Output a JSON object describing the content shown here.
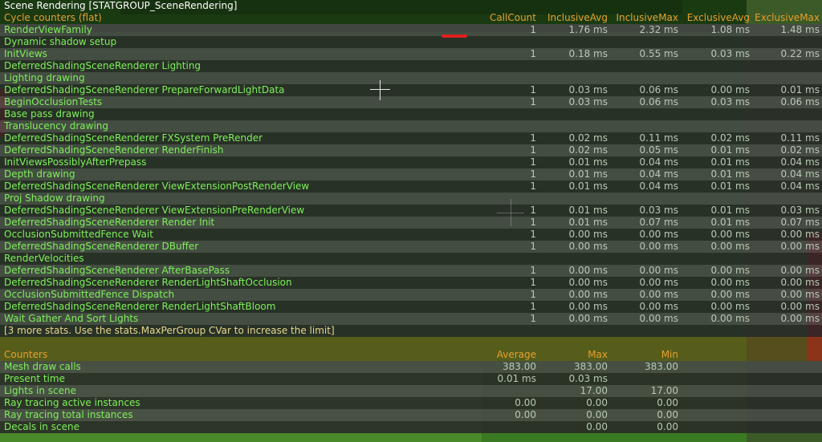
{
  "group_title": "Scene Rendering [STATGROUP_SceneRendering]",
  "cycle": {
    "title": "Cycle counters (flat)",
    "columns": [
      "CallCount",
      "InclusiveAvg",
      "InclusiveMax",
      "ExclusiveAvg",
      "ExclusiveMax"
    ],
    "rows": [
      {
        "name": "RenderViewFamily",
        "vals": [
          "1",
          "1.76 ms",
          "2.32 ms",
          "1.08 ms",
          "1.48 ms"
        ]
      },
      {
        "name": "Dynamic shadow setup",
        "vals": [
          "",
          "",
          "",
          "",
          ""
        ]
      },
      {
        "name": "InitViews",
        "vals": [
          "1",
          "0.18 ms",
          "0.55 ms",
          "0.03 ms",
          "0.22 ms"
        ]
      },
      {
        "name": "DeferredShadingSceneRenderer Lighting",
        "vals": [
          "",
          "",
          "",
          "",
          ""
        ]
      },
      {
        "name": "Lighting drawing",
        "vals": [
          "",
          "",
          "",
          "",
          ""
        ]
      },
      {
        "name": "DeferredShadingSceneRenderer PrepareForwardLightData",
        "vals": [
          "1",
          "0.03 ms",
          "0.06 ms",
          "0.00 ms",
          "0.01 ms"
        ]
      },
      {
        "name": "BeginOcclusionTests",
        "vals": [
          "1",
          "0.03 ms",
          "0.06 ms",
          "0.03 ms",
          "0.06 ms"
        ]
      },
      {
        "name": "Base pass drawing",
        "vals": [
          "",
          "",
          "",
          "",
          ""
        ]
      },
      {
        "name": "Translucency drawing",
        "vals": [
          "",
          "",
          "",
          "",
          ""
        ]
      },
      {
        "name": "DeferredShadingSceneRenderer FXSystem PreRender",
        "vals": [
          "1",
          "0.02 ms",
          "0.11 ms",
          "0.02 ms",
          "0.11 ms"
        ]
      },
      {
        "name": "DeferredShadingSceneRenderer RenderFinish",
        "vals": [
          "1",
          "0.02 ms",
          "0.05 ms",
          "0.01 ms",
          "0.02 ms"
        ]
      },
      {
        "name": "InitViewsPossiblyAfterPrepass",
        "vals": [
          "1",
          "0.01 ms",
          "0.04 ms",
          "0.01 ms",
          "0.04 ms"
        ]
      },
      {
        "name": "Depth drawing",
        "vals": [
          "1",
          "0.01 ms",
          "0.04 ms",
          "0.01 ms",
          "0.04 ms"
        ]
      },
      {
        "name": "DeferredShadingSceneRenderer ViewExtensionPostRenderView",
        "vals": [
          "1",
          "0.01 ms",
          "0.04 ms",
          "0.01 ms",
          "0.04 ms"
        ]
      },
      {
        "name": "Proj Shadow drawing",
        "vals": [
          "",
          "",
          "",
          "",
          ""
        ]
      },
      {
        "name": "DeferredShadingSceneRenderer ViewExtensionPreRenderView",
        "vals": [
          "1",
          "0.01 ms",
          "0.03 ms",
          "0.01 ms",
          "0.03 ms"
        ]
      },
      {
        "name": "DeferredShadingSceneRenderer Render Init",
        "vals": [
          "1",
          "0.01 ms",
          "0.07 ms",
          "0.01 ms",
          "0.07 ms"
        ]
      },
      {
        "name": "OcclusionSubmittedFence Wait",
        "vals": [
          "1",
          "0.00 ms",
          "0.00 ms",
          "0.00 ms",
          "0.00 ms"
        ]
      },
      {
        "name": "DeferredShadingSceneRenderer DBuffer",
        "vals": [
          "1",
          "0.00 ms",
          "0.00 ms",
          "0.00 ms",
          "0.00 ms"
        ]
      },
      {
        "name": "RenderVelocities",
        "vals": [
          "",
          "",
          "",
          "",
          ""
        ]
      },
      {
        "name": "DeferredShadingSceneRenderer AfterBasePass",
        "vals": [
          "1",
          "0.00 ms",
          "0.00 ms",
          "0.00 ms",
          "0.00 ms"
        ]
      },
      {
        "name": "DeferredShadingSceneRenderer RenderLightShaftOcclusion",
        "vals": [
          "1",
          "0.00 ms",
          "0.00 ms",
          "0.00 ms",
          "0.00 ms"
        ]
      },
      {
        "name": "OcclusionSubmittedFence Dispatch",
        "vals": [
          "1",
          "0.00 ms",
          "0.00 ms",
          "0.00 ms",
          "0.00 ms"
        ]
      },
      {
        "name": "DeferredShadingSceneRenderer RenderLightShaftBloom",
        "vals": [
          "1",
          "0.00 ms",
          "0.00 ms",
          "0.00 ms",
          "0.00 ms"
        ]
      },
      {
        "name": "Wait Gather And Sort Lights",
        "vals": [
          "1",
          "0.00 ms",
          "0.00 ms",
          "0.00 ms",
          "0.00 ms"
        ]
      }
    ],
    "more_note": "[3 more stats. Use the stats.MaxPerGroup CVar to increase the limit]"
  },
  "counters": {
    "title": "Counters",
    "columns": [
      "Average",
      "Max",
      "Min"
    ],
    "rows": [
      {
        "name": "Mesh draw calls",
        "vals": [
          "383.00",
          "383.00",
          "383.00"
        ]
      },
      {
        "name": "Present time",
        "vals": [
          "0.01 ms",
          "0.03 ms",
          ""
        ]
      },
      {
        "name": "Lights in scene",
        "vals": [
          "",
          "17.00",
          "17.00"
        ]
      },
      {
        "name": "Ray tracing active instances",
        "vals": [
          "0.00",
          "0.00",
          "0.00"
        ]
      },
      {
        "name": "Ray tracing total instances",
        "vals": [
          "0.00",
          "0.00",
          "0.00"
        ]
      },
      {
        "name": "Decals in scene",
        "vals": [
          "",
          "0.00",
          "0.00"
        ]
      }
    ]
  },
  "colors": {
    "header": "#e6a02e",
    "stat_name": "#7ef05a",
    "value": "#b8cab4"
  }
}
